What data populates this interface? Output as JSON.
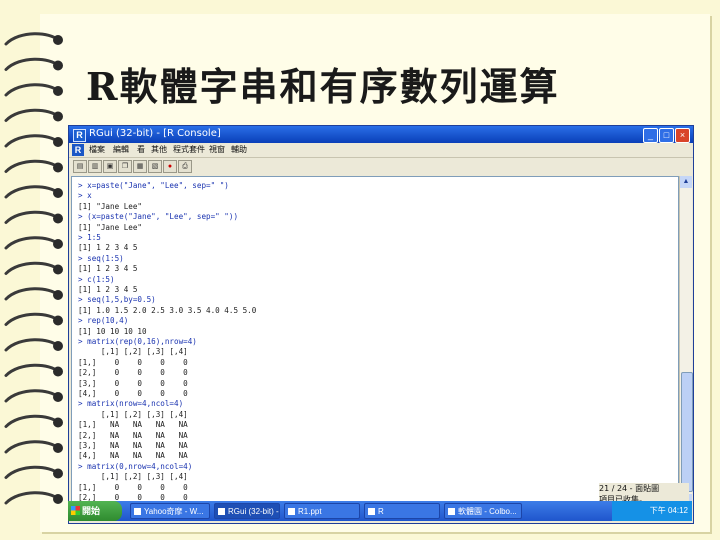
{
  "slide": {
    "title": "R軟體字串和有序數列運算"
  },
  "window": {
    "title": "RGui (32-bit) - [R Console]",
    "controls": {
      "minimize": "_",
      "maximize": "□",
      "close": "×"
    },
    "menu": [
      "檔案",
      "編輯",
      "看",
      "其他",
      "程式套件",
      "視窗",
      "輔助"
    ],
    "toolbar_icons": [
      "open-icon",
      "load-icon",
      "save-icon",
      "copy-icon",
      "paste-icon",
      "copy-paste-icon",
      "stop-icon",
      "print-icon"
    ]
  },
  "console": {
    "lines": [
      {
        "type": "cmd",
        "text": "> x=paste(\"Jane\", \"Lee\", sep=\" \")"
      },
      {
        "type": "cmd",
        "text": "> x"
      },
      {
        "type": "out",
        "text": "[1] \"Jane Lee\""
      },
      {
        "type": "cmd",
        "text": "> (x=paste(\"Jane\", \"Lee\", sep=\" \"))"
      },
      {
        "type": "out",
        "text": "[1] \"Jane Lee\""
      },
      {
        "type": "cmd",
        "text": "> 1:5"
      },
      {
        "type": "out",
        "text": "[1] 1 2 3 4 5"
      },
      {
        "type": "cmd",
        "text": "> seq(1:5)"
      },
      {
        "type": "out",
        "text": "[1] 1 2 3 4 5"
      },
      {
        "type": "cmd",
        "text": "> c(1:5)"
      },
      {
        "type": "out",
        "text": "[1] 1 2 3 4 5"
      },
      {
        "type": "cmd",
        "text": "> seq(1,5,by=0.5)"
      },
      {
        "type": "out",
        "text": "[1] 1.0 1.5 2.0 2.5 3.0 3.5 4.0 4.5 5.0"
      },
      {
        "type": "cmd",
        "text": "> rep(10,4)"
      },
      {
        "type": "out",
        "text": "[1] 10 10 10 10"
      },
      {
        "type": "cmd",
        "text": "> matrix(rep(0,16),nrow=4)"
      },
      {
        "type": "out",
        "text": "     [,1] [,2] [,3] [,4]"
      },
      {
        "type": "out",
        "text": "[1,]    0    0    0    0"
      },
      {
        "type": "out",
        "text": "[2,]    0    0    0    0"
      },
      {
        "type": "out",
        "text": "[3,]    0    0    0    0"
      },
      {
        "type": "out",
        "text": "[4,]    0    0    0    0"
      },
      {
        "type": "cmd",
        "text": "> matrix(nrow=4,ncol=4)"
      },
      {
        "type": "out",
        "text": "     [,1] [,2] [,3] [,4]"
      },
      {
        "type": "out",
        "text": "[1,]   NA   NA   NA   NA"
      },
      {
        "type": "out",
        "text": "[2,]   NA   NA   NA   NA"
      },
      {
        "type": "out",
        "text": "[3,]   NA   NA   NA   NA"
      },
      {
        "type": "out",
        "text": "[4,]   NA   NA   NA   NA"
      },
      {
        "type": "cmd",
        "text": "> matrix(0,nrow=4,ncol=4)"
      },
      {
        "type": "out",
        "text": "     [,1] [,2] [,3] [,4]"
      },
      {
        "type": "out",
        "text": "[1,]    0    0    0    0"
      },
      {
        "type": "out",
        "text": "[2,]    0    0    0    0"
      }
    ]
  },
  "status_popup": {
    "line1": "21 / 24 - 面貼圖",
    "line2": "項目已收集。"
  },
  "taskbar": {
    "start_label": "開始",
    "tasks": [
      "Yahoo奇摩 - W...",
      "RGui (32-bit) - [...",
      "R1.ppt",
      "R",
      "軟體園 - Colbo..."
    ],
    "clock": "下午 04:12"
  },
  "colors": {
    "command_text": "#1a33b0",
    "title_bar": "#0a3fb8",
    "taskbar": "#1f55cc"
  }
}
